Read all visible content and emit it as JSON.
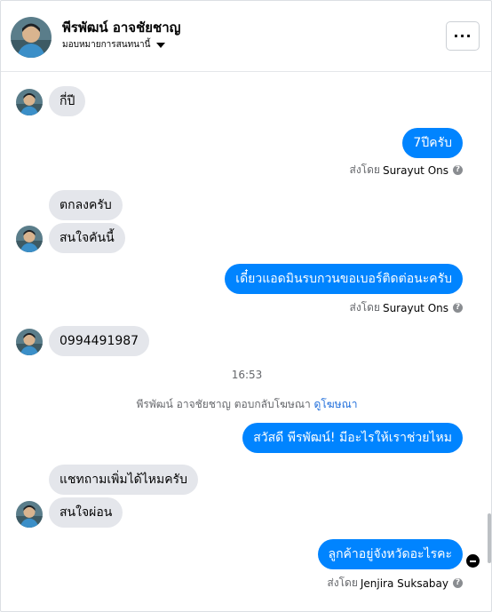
{
  "header": {
    "name": "พีรพัฒน์ อาจชัยชาญ",
    "subtitle": "มอบหมายการสนทนานี้",
    "more_label": "···"
  },
  "messages": [
    {
      "dir": "in",
      "text": "กี่ปี"
    },
    {
      "dir": "out",
      "text": "7ปีครับ",
      "sent_prefix": "ส่งโดย",
      "sent_by": "Surayut Ons"
    },
    {
      "dir": "in",
      "text": "ตกลงครับ"
    },
    {
      "dir": "in",
      "text": "สนใจคันนี้"
    },
    {
      "dir": "out",
      "text": "เดี๋ยวแอดมินรบกวนขอเบอร์ติดต่อนะครับ",
      "sent_prefix": "ส่งโดย",
      "sent_by": "Surayut Ons"
    },
    {
      "dir": "in",
      "text": "0994491987"
    },
    {
      "dir": "out",
      "text": "สวัสดี พีรพัฒน์! มีอะไรให้เราช่วยไหม"
    },
    {
      "dir": "in",
      "text": "แชทถามเพิ่มได้ไหมครับ"
    },
    {
      "dir": "in",
      "text": "สนใจผ่อน"
    },
    {
      "dir": "out",
      "text": "ลูกค้าอยู่จังหวัดอะไรคะ",
      "sent_prefix": "ส่งโดย",
      "sent_by": "Jenjira Suksabay"
    }
  ],
  "timestamp": "16:53",
  "ad_reply": {
    "text": "พีรพัฒน์ อาจชัยชาญ ตอบกลับโฆษณา",
    "link": "ดูโฆษณา"
  },
  "icons": {
    "help": "?"
  },
  "colors": {
    "outgoing": "#0084ff",
    "incoming": "#e4e6eb",
    "link": "#216fdb"
  }
}
